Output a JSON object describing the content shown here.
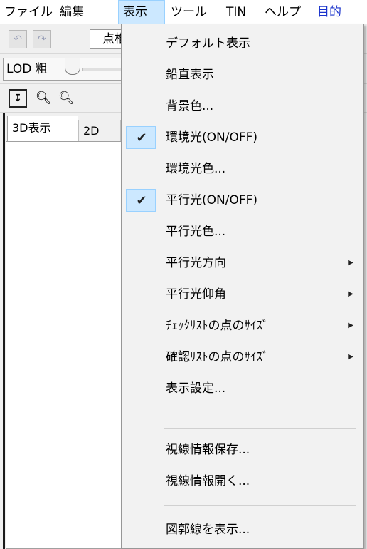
{
  "menubar": {
    "items": [
      {
        "label": "ファイル"
      },
      {
        "label": "編集"
      },
      {
        "label": "表示"
      },
      {
        "label": "ツール"
      },
      {
        "label": "TIN"
      },
      {
        "label": "ヘルプ"
      },
      {
        "label": "目的"
      }
    ]
  },
  "toolbar": {
    "undo_icon": "undo-icon",
    "redo_icon": "redo-icon",
    "point_field_value": "点椎",
    "lod_label": "LOD 粗"
  },
  "nav": {
    "tool1_icon": "jump-icon",
    "tool2_icon": "zoom-out-icon",
    "tool3_icon": "zoom-in-icon"
  },
  "tabs": [
    {
      "label": "3D表示"
    },
    {
      "label": "2D"
    }
  ],
  "dropdown": {
    "items": [
      {
        "label": "デフォルト表示",
        "checked": false,
        "submenu": false
      },
      {
        "label": "鉛直表示",
        "checked": false,
        "submenu": false
      },
      {
        "label": "背景色...",
        "checked": false,
        "submenu": false
      },
      {
        "label": "環境光(ON/OFF)",
        "checked": true,
        "submenu": false
      },
      {
        "label": "環境光色...",
        "checked": false,
        "submenu": false
      },
      {
        "label": "平行光(ON/OFF)",
        "checked": true,
        "submenu": false
      },
      {
        "label": "平行光色...",
        "checked": false,
        "submenu": false
      },
      {
        "label": "平行光方向",
        "checked": false,
        "submenu": true
      },
      {
        "label": "平行光仰角",
        "checked": false,
        "submenu": true
      },
      {
        "label": "ﾁｪｯｸﾘｽﾄの点のｻｲｽﾞ",
        "checked": false,
        "submenu": true
      },
      {
        "label": "確認ﾘｽﾄの点のｻｲｽﾞ",
        "checked": false,
        "submenu": true
      },
      {
        "label": "表示設定...",
        "checked": false,
        "submenu": false
      },
      {
        "label": "視線情報保存...",
        "checked": false,
        "submenu": false
      },
      {
        "label": "視線情報開く...",
        "checked": false,
        "submenu": false
      },
      {
        "label": "図郭線を表示...",
        "checked": false,
        "submenu": false
      }
    ],
    "check_glyph": "✔",
    "arrow_glyph": "▶"
  },
  "colors": {
    "menu_highlight": "#cce8ff",
    "menu_highlight_border": "#99d1ff",
    "menu_bg": "#f2f2f2",
    "accent_blue_text": "#1a33cc"
  }
}
